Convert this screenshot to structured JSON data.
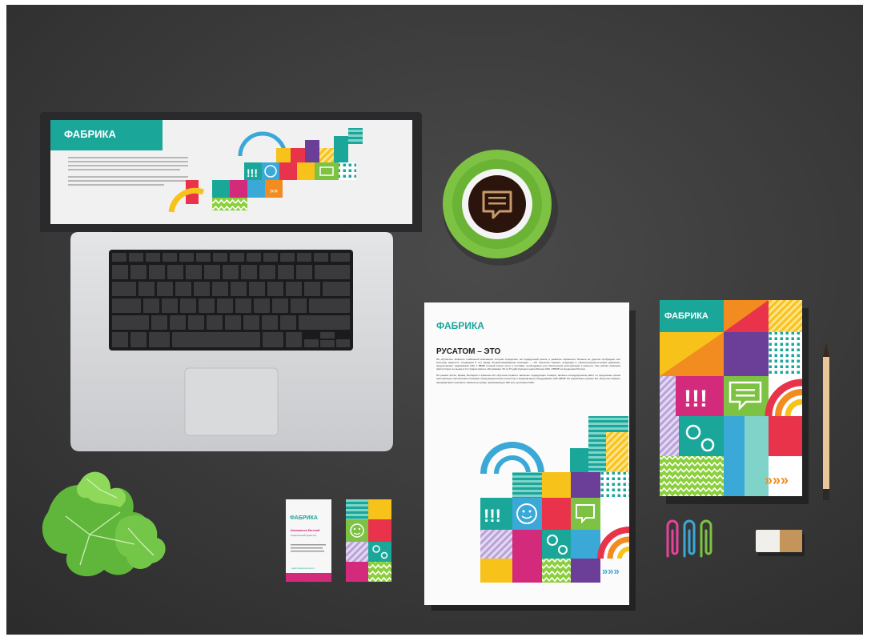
{
  "brand": {
    "logo_text": "ФАБРИКА"
  },
  "letterhead": {
    "heading": "РУСАТОМ – ЭТО",
    "paragraph_1": "ПК «Русатом» является глобальной компанией, которая определяет им лидирующий рынок, и развитие сервисного бизнеса не удается пробуждает все большую важность. Созданная 5 лет назад специализированная компания — АО «Русатом Сервис» входящая в «Электроэнергетический дивизион» предоставляет зарубежным АЭС с ВВЭР полный спектр услуг и поставки, необходимых для обеспечения эксплуатации и ремонта. Уже сейчас компания присутствует на рынке в 11 странах мира и обслуживает 25 из 37 действующих энергоблоков АЭС с ВВЭР за пределами России.",
    "paragraph_2": "На рынках Китая, Ирана, Болгарии и Армении АО «Русатом Сервис» заключил лидирующие позиции, являясь генподрядчиком работ по продлению сроков эксплуатации, выполнению плановых предупредительных ремонтов и модернизации оборудования АЭС ВВЭР. На зарубежных рынках АО «Русатом Сервис» сформировало портфель заказов на сумму, превышающую 840 млн. долларов США."
  },
  "business_card": {
    "name": "Шаповалов Евгений",
    "job_title": "Генеральный директор",
    "website": "www.rusatomservice.ru"
  },
  "colors": {
    "teal": "#1aa79a",
    "green": "#7dc242",
    "yellow": "#f7c21a",
    "orange": "#f28b20",
    "red": "#e8334a",
    "magenta": "#d42a7c",
    "purple": "#6b3e97",
    "blue": "#3aa9d8",
    "lime": "#8ccf3c"
  }
}
